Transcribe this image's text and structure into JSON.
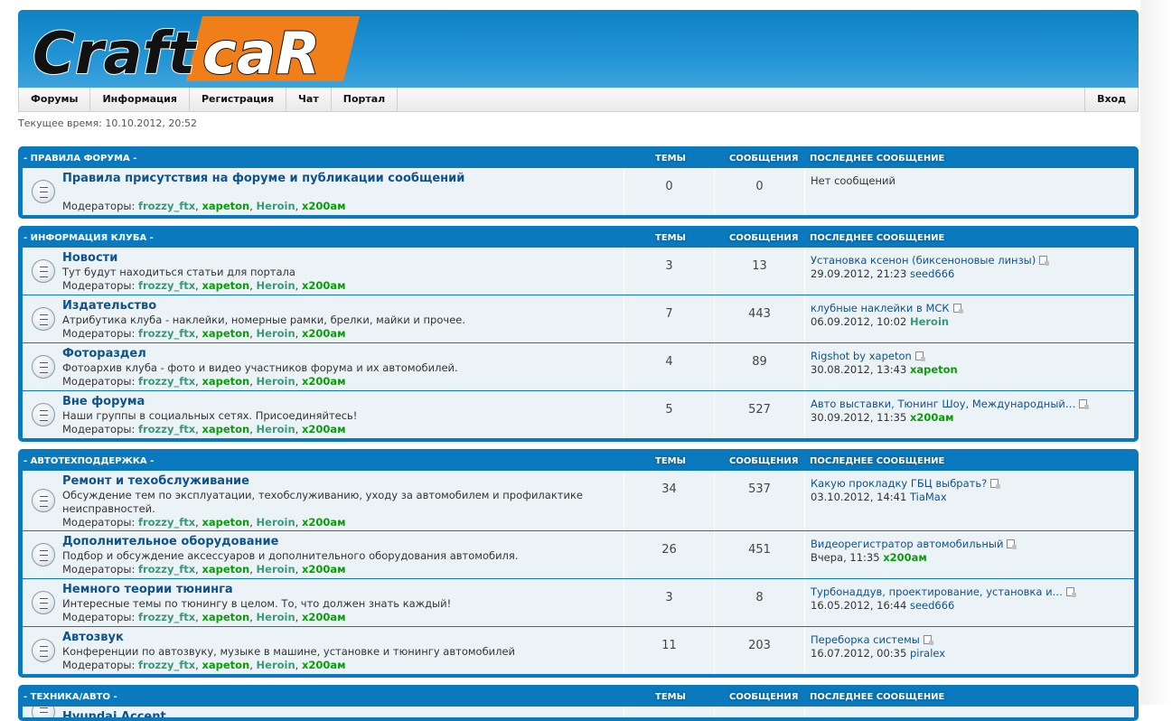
{
  "logo": {
    "text_left": "Craft",
    "text_right": "caR"
  },
  "nav": {
    "items": [
      "Форумы",
      "Информация",
      "Регистрация",
      "Чат",
      "Портал"
    ],
    "login": "Вход"
  },
  "current_time": "Текущее время: 10.10.2012, 20:52",
  "columns": {
    "topics": "ТЕМЫ",
    "posts": "СООБЩЕНИЯ",
    "last": "ПОСЛЕДНЕЕ СООБЩЕНИЕ"
  },
  "moderators_label": "Модераторы:",
  "moderators": [
    "frozzy_ftx",
    "xapeton",
    "Heroin",
    "x200ам"
  ],
  "categories": [
    {
      "title": "- ПРАВИЛА ФОРУМА -",
      "forums": [
        {
          "title": "Правила присутствия на форуме и публикации сообщений",
          "desc": "",
          "topics": "0",
          "posts": "0",
          "last_topic": "Нет сообщений",
          "last_date": "",
          "last_author": "",
          "author_style": "plain"
        }
      ]
    },
    {
      "title": "- ИНФОРМАЦИЯ КЛУБА -",
      "forums": [
        {
          "title": "Новости",
          "desc": "Тут будут находиться статьи для портала",
          "topics": "3",
          "posts": "13",
          "last_topic": "Установка ксенон (биксеноновые линзы)",
          "last_date": "29.09.2012, 21:23",
          "last_author": "seed666",
          "author_style": "plain"
        },
        {
          "title": "Издательство",
          "desc": "Атрибутика клуба - наклейки, номерные рамки, брелки, майки и прочее.",
          "topics": "7",
          "posts": "443",
          "last_topic": "клубные наклейки в МСК",
          "last_date": "06.09.2012, 10:02",
          "last_author": "Heroin",
          "author_style": "teal"
        },
        {
          "title": "Фотораздел",
          "desc": "Фотоархив клуба - фото и видео участников форума и их автомобилей.",
          "topics": "4",
          "posts": "89",
          "last_topic": "Rigshot by xapeton",
          "last_date": "30.08.2012, 13:43",
          "last_author": "xapeton",
          "author_style": "green"
        },
        {
          "title": "Вне форума",
          "desc": "Наши группы в социальных сетях. Присоединяйтесь!",
          "topics": "5",
          "posts": "527",
          "last_topic": "Авто выставки, Тюнинг Шоу, Международный…",
          "last_date": "30.09.2012, 11:35",
          "last_author": "x200ам",
          "author_style": "green"
        }
      ]
    },
    {
      "title": "- АВТОТЕХПОДДЕРЖКА -",
      "forums": [
        {
          "title": "Ремонт и техобслуживание",
          "desc": "Обсуждение тем по эксплуатации, техобслуживанию, уходу за автомобилем и профилактике неисправностей.",
          "topics": "34",
          "posts": "537",
          "last_topic": "Какую прокладку ГБЦ выбрать?",
          "last_date": "03.10.2012, 14:41",
          "last_author": "TiaMax",
          "author_style": "plain"
        },
        {
          "title": "Дополнительное оборудование",
          "desc": "Подбор и обсуждение аксессуаров и дополнительного оборудования автомобиля.",
          "topics": "26",
          "posts": "451",
          "last_topic": "Видеорегистратор автомобильный",
          "last_date": "Вчера, 11:35",
          "last_author": "x200ам",
          "author_style": "green"
        },
        {
          "title": "Немного теории тюнинга",
          "desc": "Интересные темы по тюнингу в целом. То, что должен знать каждый!",
          "topics": "3",
          "posts": "8",
          "last_topic": "Турбонаддув, проектирование, установка и…",
          "last_date": "16.05.2012, 16:44",
          "last_author": "seed666",
          "author_style": "plain"
        },
        {
          "title": "Автозвук",
          "desc": "Конференции по автозвуку, музыке в машине, установке и тюнингу автомобилей",
          "topics": "11",
          "posts": "203",
          "last_topic": "Переборка системы",
          "last_date": "16.07.2012, 00:35",
          "last_author": "piralex",
          "author_style": "plain"
        }
      ]
    },
    {
      "title": "- ТЕХНИКА/АВТО -",
      "forums": [
        {
          "title": "Hyundai Accent",
          "desc": "",
          "topics": "",
          "posts": "",
          "last_topic": "",
          "last_date": "",
          "last_author": "",
          "author_style": "plain"
        }
      ]
    }
  ]
}
